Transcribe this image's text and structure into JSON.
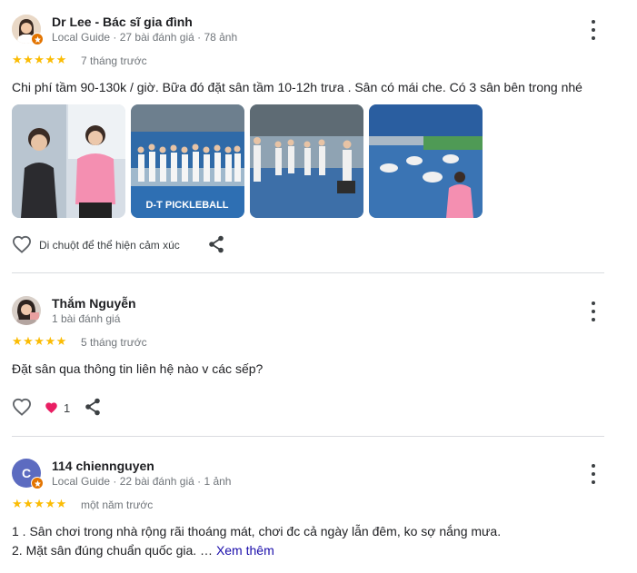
{
  "reviews": [
    {
      "author": "Dr Lee - Bác sĩ gia đình",
      "meta": "Local Guide · 27 bài đánh giá · 78 ảnh",
      "stars": "★★★★★",
      "time": "7 tháng trước",
      "text": "Chi phí tầm 90-130k / giờ. Bữa đó đặt sân tầm 10-12h trưa . Sân có mái che. Có 3 sân bên trong nhé",
      "photo2_caption": "D-T PICKLEBALL",
      "reaction_hint": "Di chuột để thể hiện cảm xúc"
    },
    {
      "author": "Thắm Nguyễn",
      "meta": "1 bài đánh giá",
      "stars": "★★★★★",
      "time": "5 tháng trước",
      "text": "Đặt sân qua thông tin liên hệ nào v các sếp?",
      "like_count": "1"
    },
    {
      "author": "114 chiennguyen",
      "avatar_letter": "C",
      "meta": "Local Guide · 22 bài đánh giá · 1 ảnh",
      "stars": "★★★★★",
      "time": "một năm trước",
      "text_line1": "1 . Sân chơi trong nhà rộng rãi thoáng mát, chơi đc cả ngày lẫn đêm, ko sợ nắng mưa.",
      "text_line2": "2. Mặt sân đúng chuẩn quốc gia. …",
      "more_link": "Xem thêm"
    }
  ],
  "colors": {
    "star": "#fbbc04",
    "link": "#1a0dab",
    "avatar_c": "#5c6bc0",
    "heart": "#e91e63",
    "badge": "#e37400"
  }
}
